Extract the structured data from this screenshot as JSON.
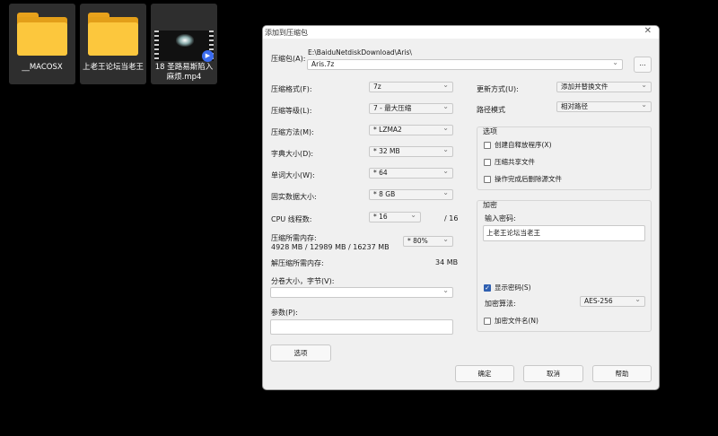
{
  "desktop": {
    "items": [
      {
        "label": "__MACOSX"
      },
      {
        "label": "上老王论坛当老王"
      },
      {
        "label": "18 圣路易斯陷入麻烦.mp4"
      }
    ]
  },
  "dialog": {
    "title": "添加到压缩包",
    "archive_label": "压缩包(A):",
    "archive_path": "E:\\BaiduNetdiskDownload\\Aris\\",
    "archive_name": "Aris.7z",
    "browse_button": "...",
    "left": {
      "format_label": "压缩格式(F):",
      "format_value": "7z",
      "level_label": "压缩等级(L):",
      "level_value": "7 - 最大压缩",
      "method_label": "压缩方法(M):",
      "method_value": "*  LZMA2",
      "dict_label": "字典大小(D):",
      "dict_value": "*  32 MB",
      "word_label": "单词大小(W):",
      "word_value": "*  64",
      "solid_label": "固实数据大小:",
      "solid_value": "*  8 GB",
      "cpu_label": "CPU 线程数:",
      "cpu_value": "*  16",
      "cpu_total": "/ 16",
      "mem_compress_label": "压缩所需内存:",
      "mem_compress_detail": "4928 MB / 12989 MB / 16237 MB",
      "mem_percent": "* 80%",
      "mem_decompress_label": "解压缩所需内存:",
      "mem_decompress_value": "34 MB",
      "split_label": "分卷大小，字节(V):",
      "split_value": "",
      "params_label": "参数(P):",
      "params_value": "",
      "options_button": "选项"
    },
    "right": {
      "update_label": "更新方式(U):",
      "update_value": "添加并替换文件",
      "path_label": "路径模式",
      "path_value": "相对路径",
      "options_title": "选项",
      "opt_sfx": "创建自释放程序(X)",
      "opt_shared": "压缩共享文件",
      "opt_delete": "操作完成后删除源文件",
      "encrypt_title": "加密",
      "password_label": "输入密码:",
      "password_value": "上老王论坛当老王",
      "show_password": "显示密码(S)",
      "method_label": "加密算法:",
      "method_value": "AES-256",
      "encrypt_names": "加密文件名(N)"
    },
    "buttons": {
      "ok": "确定",
      "cancel": "取消",
      "help": "帮助"
    }
  }
}
